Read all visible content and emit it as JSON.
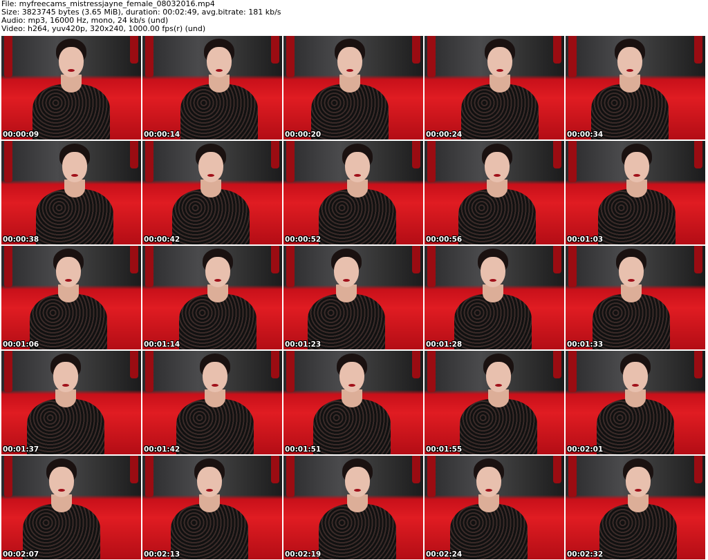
{
  "header": {
    "file": "File: myfreecams_mistressjayne_female_08032016.mp4",
    "size": "Size: 3823745 bytes (3.65 MiB), duration: 00:02:49, avg.bitrate: 181 kb/s",
    "audio": "Audio: mp3, 16000 Hz, mono, 24 kb/s (und)",
    "video": "Video: h264, yuv420p, 320x240, 1000.00 fps(r) (und)"
  },
  "thumbnails": [
    {
      "timestamp": "00:00:09"
    },
    {
      "timestamp": "00:00:14"
    },
    {
      "timestamp": "00:00:20"
    },
    {
      "timestamp": "00:00:24"
    },
    {
      "timestamp": "00:00:34"
    },
    {
      "timestamp": "00:00:38"
    },
    {
      "timestamp": "00:00:42"
    },
    {
      "timestamp": "00:00:52"
    },
    {
      "timestamp": "00:00:56"
    },
    {
      "timestamp": "00:01:03"
    },
    {
      "timestamp": "00:01:06"
    },
    {
      "timestamp": "00:01:14"
    },
    {
      "timestamp": "00:01:23"
    },
    {
      "timestamp": "00:01:28"
    },
    {
      "timestamp": "00:01:33"
    },
    {
      "timestamp": "00:01:37"
    },
    {
      "timestamp": "00:01:42"
    },
    {
      "timestamp": "00:01:51"
    },
    {
      "timestamp": "00:01:55"
    },
    {
      "timestamp": "00:02:01"
    },
    {
      "timestamp": "00:02:07"
    },
    {
      "timestamp": "00:02:13"
    },
    {
      "timestamp": "00:02:19"
    },
    {
      "timestamp": "00:02:24"
    },
    {
      "timestamp": "00:02:32"
    }
  ]
}
